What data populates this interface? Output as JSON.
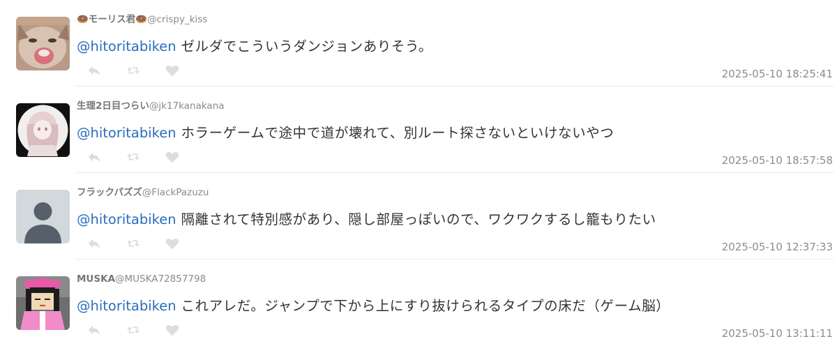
{
  "replies": [
    {
      "name": "🍩モーリス君🍩",
      "handle": "@crispy_kiss",
      "mention": "@hitoritabiken",
      "text": " ゼルダでこういうダンジョンありそう。",
      "time": "2025-05-10 18:25:41",
      "avatar_icon": "cat-photo-avatar"
    },
    {
      "name": "生理2日目つらい",
      "handle": "@jk17kanakana",
      "mention": "@hitoritabiken",
      "text": " ホラーゲームで途中で道が壊れて、別ルート探さないといけないやつ",
      "time": "2025-05-10 18:57:58",
      "avatar_icon": "anime-girl-avatar"
    },
    {
      "name": "フラックパズズ",
      "handle": "@FlackPazuzu",
      "mention": "@hitoritabiken",
      "text": " 隔離されて特別感があり、隠し部屋っぽいので、ワクワクするし籠もりたい",
      "time": "2025-05-10 12:37:33",
      "avatar_icon": "default-person-avatar"
    },
    {
      "name": "MUSKA",
      "handle": "@MUSKA72857798",
      "mention": "@hitoritabiken",
      "text": " これアレだ。ジャンプで下から上にすり抜けられるタイプの床だ（ゲーム脳）",
      "time": "2025-05-10 13:11:11",
      "avatar_icon": "pixel-character-avatar"
    }
  ],
  "icons": {
    "reply": "reply-icon",
    "retweet": "retweet-icon",
    "like": "heart-icon"
  },
  "colors": {
    "mention": "#2a6ebd",
    "icon": "#dddddd",
    "meta": "#888888"
  }
}
